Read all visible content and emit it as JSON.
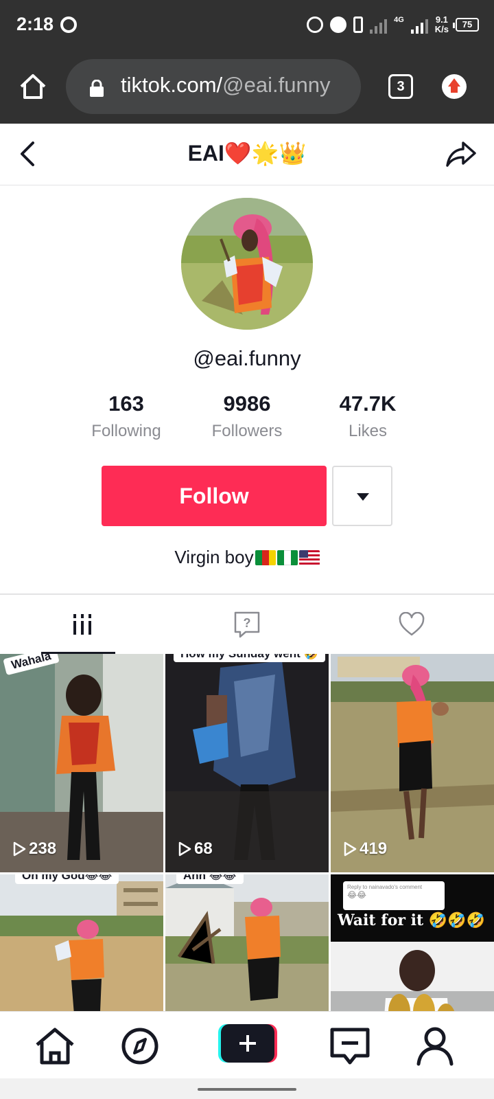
{
  "status_bar": {
    "time": "2:18",
    "network_type": "4G",
    "speed_value": "9.1",
    "speed_unit": "K/s",
    "battery": "75"
  },
  "browser": {
    "url_domain": "tiktok.com/",
    "url_path": "@eai.funny",
    "tab_count": "3"
  },
  "header": {
    "title": "EAI❤️🌟👑"
  },
  "profile": {
    "username": "@eai.funny",
    "stats": [
      {
        "value": "163",
        "label": "Following"
      },
      {
        "value": "9986",
        "label": "Followers"
      },
      {
        "value": "47.7K",
        "label": "Likes"
      }
    ],
    "follow_label": "Follow",
    "bio_text": "Virgin boy"
  },
  "tabs": [
    {
      "icon": "grid-icon",
      "active": true
    },
    {
      "icon": "question-box-icon",
      "active": false
    },
    {
      "icon": "heart-outline-icon",
      "active": false
    }
  ],
  "videos": [
    {
      "views": "238",
      "caption": "Wahala"
    },
    {
      "views": "68",
      "caption": "How my Sunday went 🤣"
    },
    {
      "views": "419",
      "caption": ""
    },
    {
      "views": "",
      "caption": "Oh my God😂😂"
    },
    {
      "views": "",
      "caption": "Ahh 😂😂"
    },
    {
      "views": "",
      "caption": "Wait for it 🤣🤣🤣",
      "reply": "Reply to nainavado's comment",
      "reply_emoji": "😂😂"
    }
  ],
  "bottom_nav": [
    {
      "icon": "home-icon"
    },
    {
      "icon": "compass-icon"
    },
    {
      "icon": "create-plus-icon"
    },
    {
      "icon": "inbox-icon"
    },
    {
      "icon": "profile-icon"
    }
  ],
  "colors": {
    "brand_red": "#fe2c55",
    "text_primary": "#161823",
    "text_secondary": "#8a8b91",
    "chrome_dark": "#313131"
  }
}
